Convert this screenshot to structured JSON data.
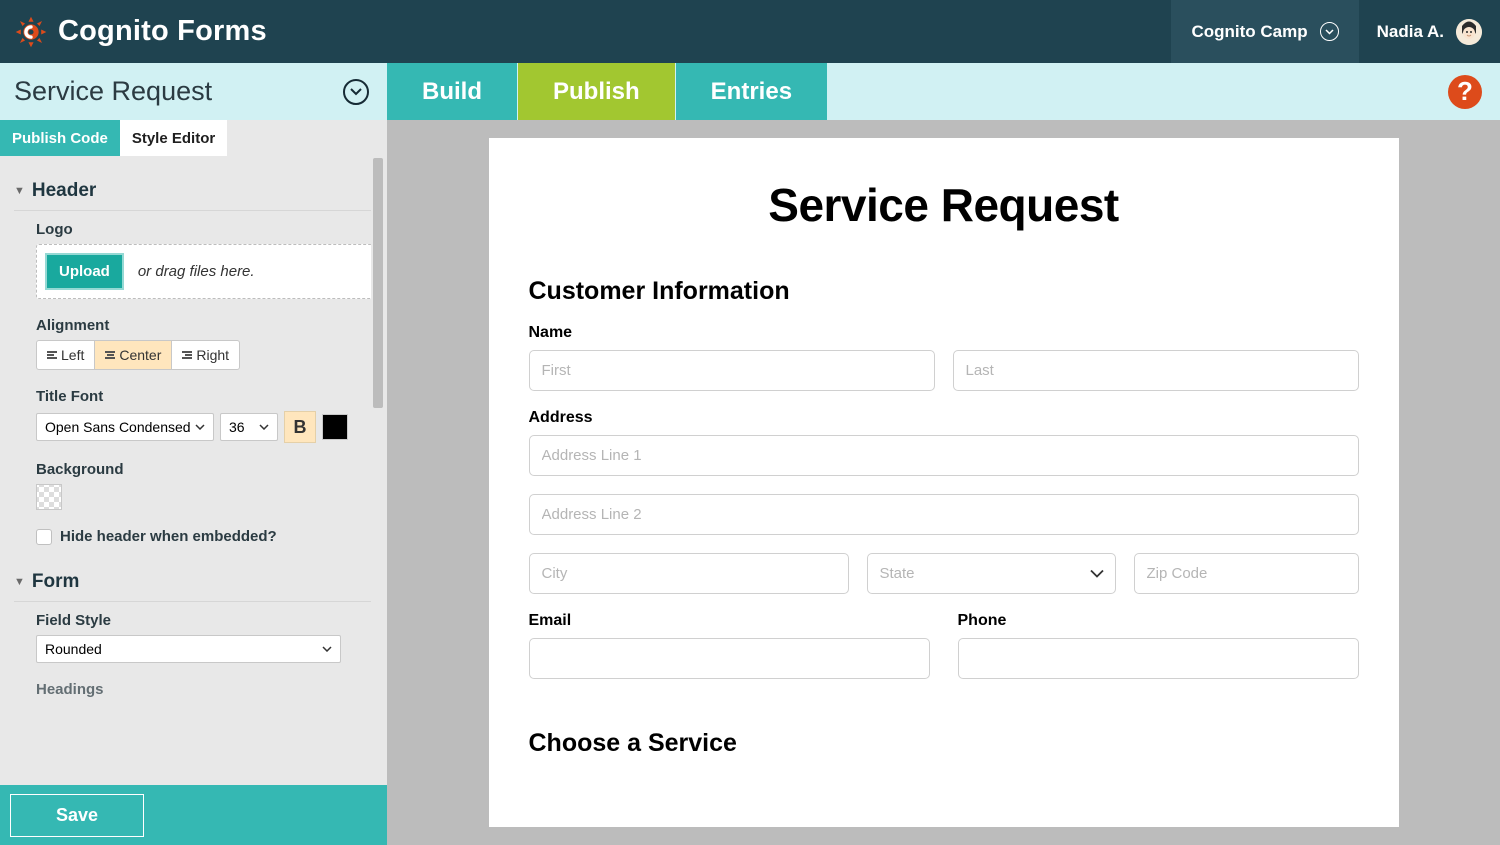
{
  "brand": "Cognito Forms",
  "org": {
    "name": "Cognito Camp"
  },
  "user": {
    "name": "Nadia A."
  },
  "formName": "Service Request",
  "nav": {
    "build": "Build",
    "publish": "Publish",
    "entries": "Entries"
  },
  "sidebarTabs": {
    "publishCode": "Publish Code",
    "styleEditor": "Style Editor"
  },
  "sections": {
    "header": {
      "title": "Header",
      "logoLabel": "Logo",
      "uploadBtn": "Upload",
      "uploadHint": "or drag files here.",
      "alignLabel": "Alignment",
      "alignLeft": "Left",
      "alignCenter": "Center",
      "alignRight": "Right",
      "titleFontLabel": "Title Font",
      "fontValue": "Open Sans Condensed",
      "fontSize": "36",
      "bold": "B",
      "backgroundLabel": "Background",
      "hideHeaderLabel": "Hide header when embedded?"
    },
    "form": {
      "title": "Form",
      "fieldStyleLabel": "Field Style",
      "fieldStyleValue": "Rounded",
      "headingsLabel": "Headings"
    }
  },
  "saveBtn": "Save",
  "helpBtn": "?",
  "preview": {
    "title": "Service Request",
    "sectionCustomer": "Customer Information",
    "nameLabel": "Name",
    "firstPh": "First",
    "lastPh": "Last",
    "addressLabel": "Address",
    "addr1Ph": "Address Line 1",
    "addr2Ph": "Address Line 2",
    "cityPh": "City",
    "statePh": "State",
    "zipPh": "Zip Code",
    "emailLabel": "Email",
    "phoneLabel": "Phone",
    "sectionService": "Choose a Service"
  }
}
